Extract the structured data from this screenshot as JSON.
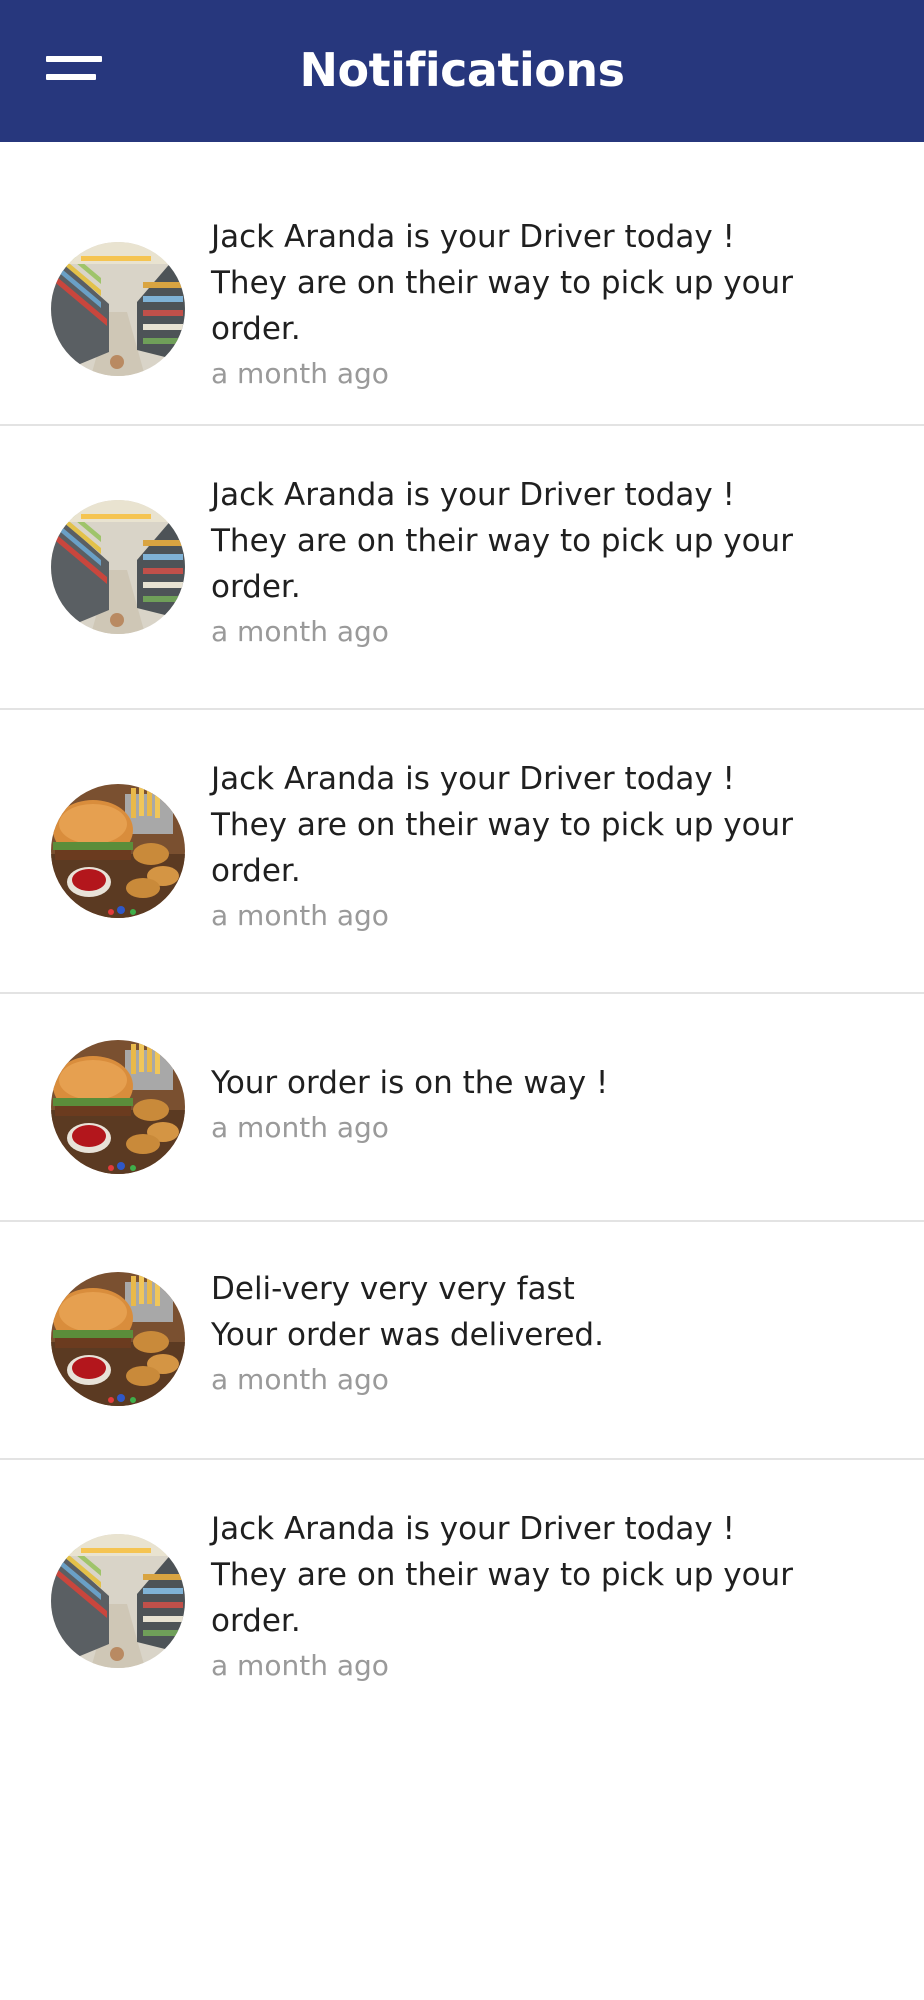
{
  "header": {
    "title": "Notifications",
    "menu_icon": "hamburger-menu-icon",
    "background": "#27377d"
  },
  "notifications": [
    {
      "avatar": "grocery-store-image",
      "lines": [
        "Jack Aranda is your Driver today !",
        "They are on their way to pick up your",
        "order."
      ],
      "time": "a month ago"
    },
    {
      "avatar": "grocery-store-image",
      "lines": [
        "Jack Aranda is your Driver today !",
        "They are on their way to pick up your",
        "order."
      ],
      "time": "a month ago"
    },
    {
      "avatar": "fast-food-image",
      "lines": [
        "Jack Aranda is your Driver today !",
        "They are on their way to pick up your",
        "order."
      ],
      "time": "a month ago"
    },
    {
      "avatar": "fast-food-image",
      "lines": [
        "Your order is on the way !"
      ],
      "time": "a month ago"
    },
    {
      "avatar": "fast-food-image",
      "lines": [
        "Deli-very very very fast",
        "Your order was delivered."
      ],
      "time": "a month ago"
    },
    {
      "avatar": "grocery-store-image",
      "lines": [
        "Jack Aranda is your Driver today !",
        "They are on their way to pick up your",
        "order."
      ],
      "time": "a month ago"
    }
  ]
}
